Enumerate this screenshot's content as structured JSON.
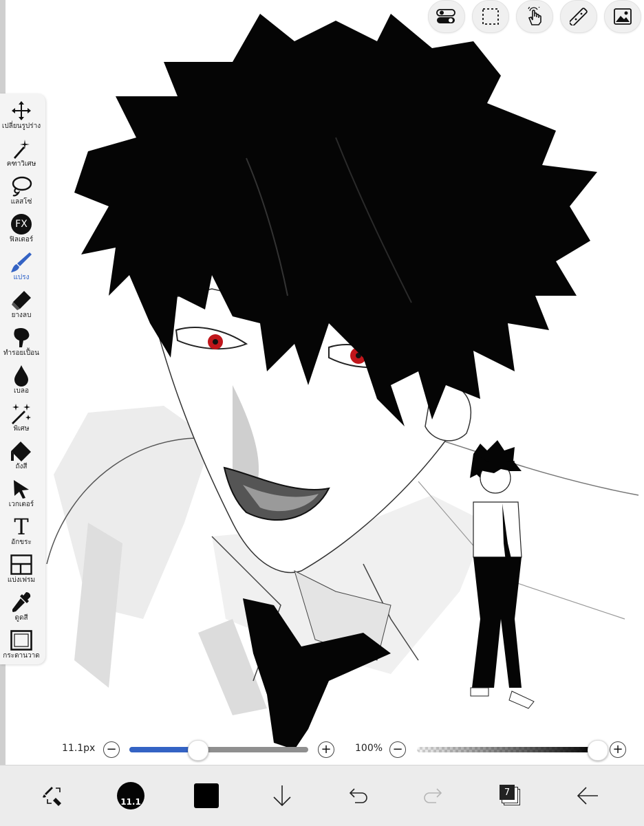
{
  "tools": [
    {
      "label": "เปลี่ยนรูปร่าง",
      "icon": "move-icon",
      "active": false
    },
    {
      "label": "คฑาวิเศษ",
      "icon": "magic-wand-icon",
      "active": false
    },
    {
      "label": "แลสโซ่",
      "icon": "lasso-icon",
      "active": false
    },
    {
      "label": "ฟิลเตอร์",
      "icon": "fx-filter-icon",
      "active": false
    },
    {
      "label": "แปรง",
      "icon": "brush-icon",
      "active": true
    },
    {
      "label": "ยางลบ",
      "icon": "eraser-icon",
      "active": false
    },
    {
      "label": "ทำรอยเปื้อน",
      "icon": "smudge-icon",
      "active": false
    },
    {
      "label": "เบลอ",
      "icon": "blur-drop-icon",
      "active": false
    },
    {
      "label": "พิเศษ",
      "icon": "special-wand-icon",
      "active": false
    },
    {
      "label": "ถังสี",
      "icon": "paint-bucket-icon",
      "active": false
    },
    {
      "label": "เวกเตอร์",
      "icon": "vector-arrow-icon",
      "active": false
    },
    {
      "label": "อักขระ",
      "icon": "text-icon",
      "active": false
    },
    {
      "label": "แบ่งเฟรม",
      "icon": "frame-divider-icon",
      "active": false
    },
    {
      "label": "ดูดสี",
      "icon": "eyedropper-icon",
      "active": false
    },
    {
      "label": "กระดานวาด",
      "icon": "canvas-icon",
      "active": false
    }
  ],
  "fx_text": "FX",
  "text_tool_glyph": "T",
  "top_toolbar": [
    "toggle-icon",
    "selection-icon",
    "touch-gesture-icon",
    "ruler-icon",
    "image-icon"
  ],
  "brush_size": {
    "label": "11.1px",
    "value_fraction": 0.38,
    "minus": "−",
    "plus": "+"
  },
  "opacity": {
    "label": "100%",
    "value_fraction": 1.0,
    "minus": "−",
    "plus": "+"
  },
  "bottom_bar": {
    "brush_preview_label": "11.1",
    "layer_count": "7",
    "color_swatch": "#000000"
  },
  "colors": {
    "accent": "#3463c4",
    "active_label": "#2f62c8",
    "eye_red": "#c0161b"
  }
}
